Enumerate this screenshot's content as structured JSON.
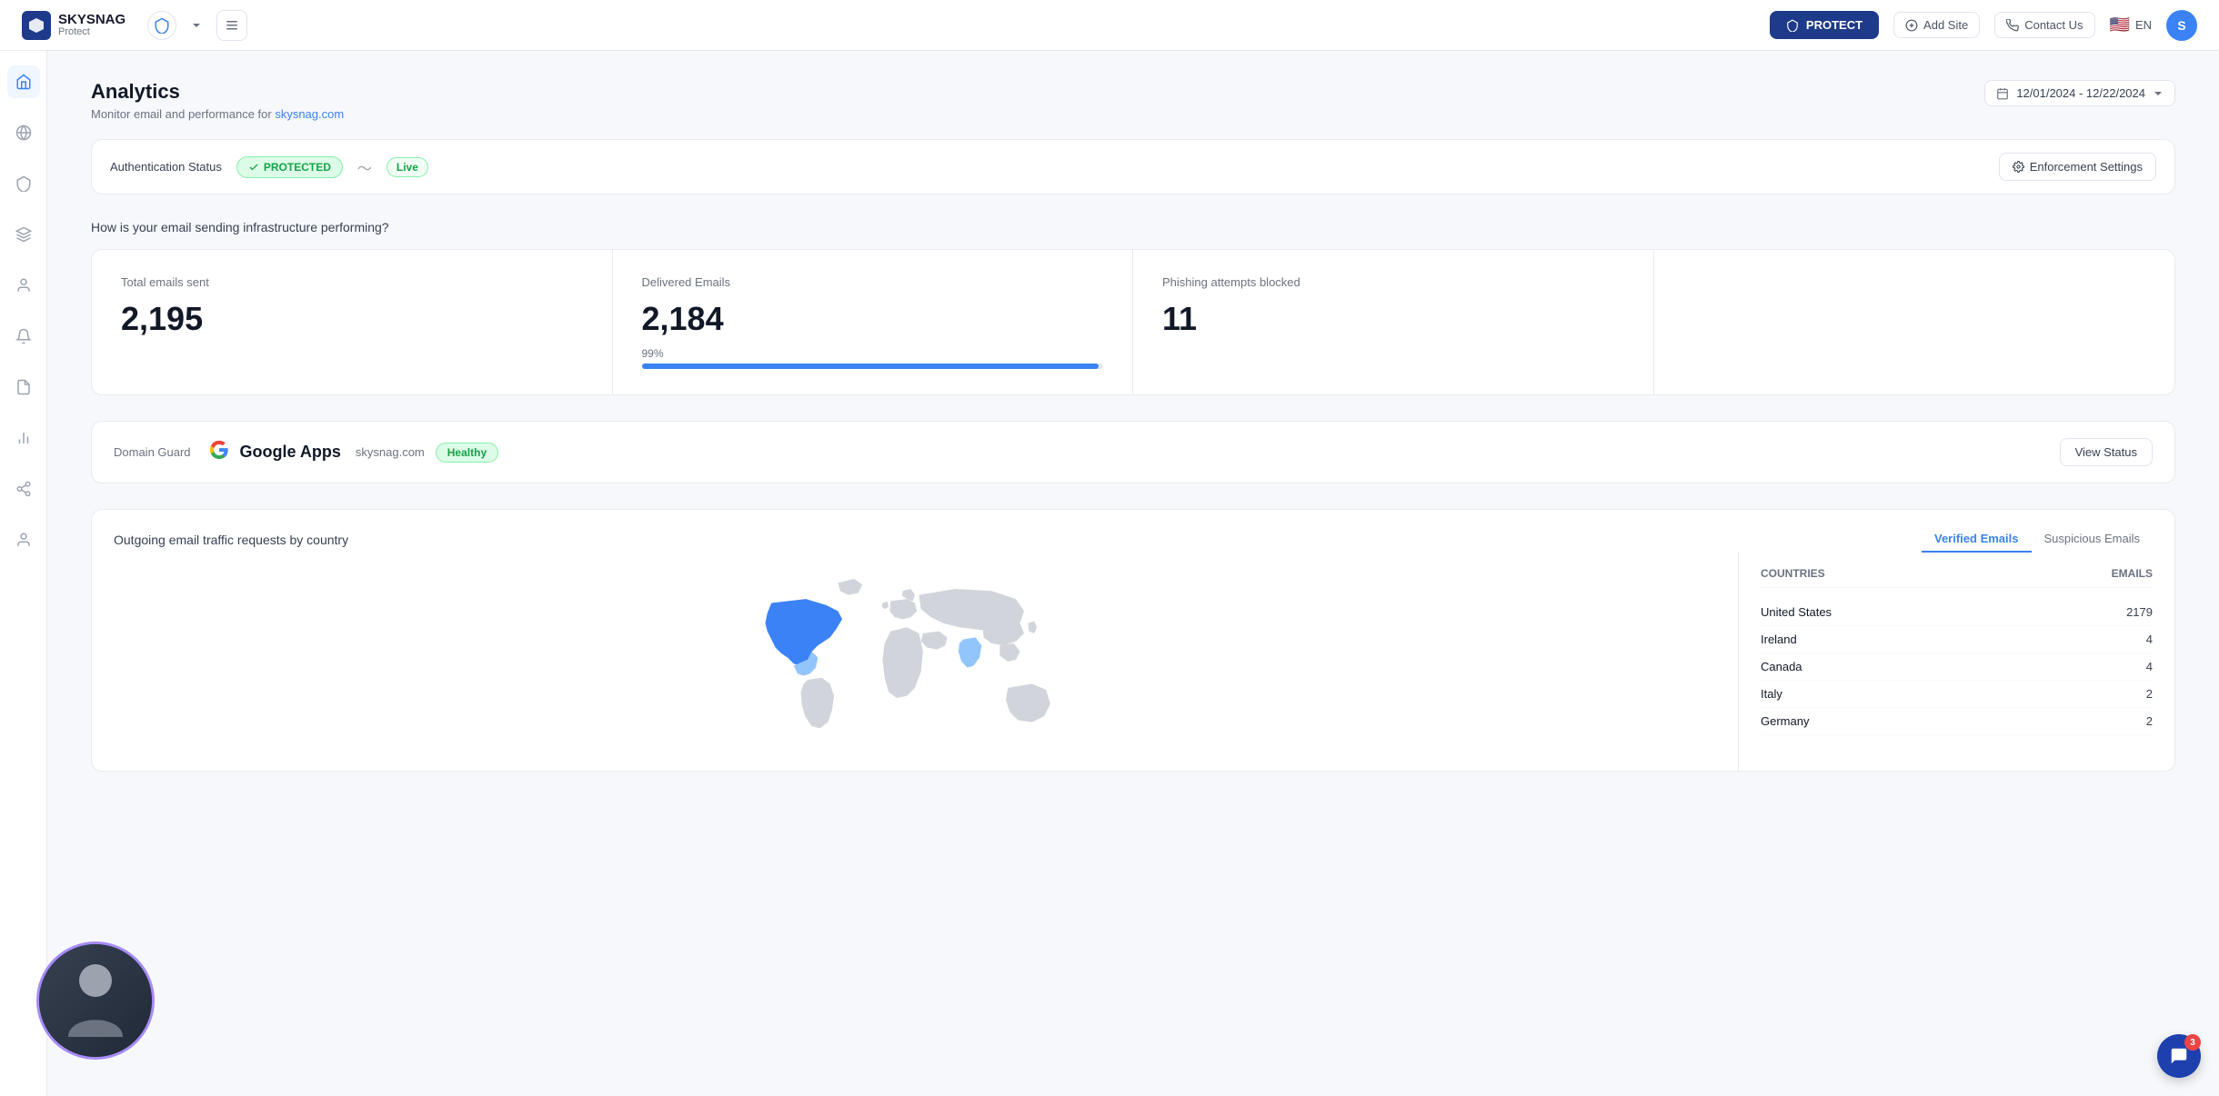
{
  "app": {
    "name": "SKYSNAG",
    "sub": "Protect"
  },
  "topbar": {
    "protect_label": "PROTECT",
    "add_site_label": "Add Site",
    "contact_us_label": "Contact Us",
    "lang": "EN",
    "avatar_initial": "S"
  },
  "sidebar": {
    "icons": [
      "home",
      "globe",
      "shield",
      "layers",
      "user",
      "bell",
      "report",
      "analytics",
      "settings",
      "user-circle"
    ]
  },
  "page": {
    "title": "Analytics",
    "subtitle": "Monitor email and performance for",
    "domain_link": "skysnag.com",
    "date_range": "12/01/2024 - 12/22/2024"
  },
  "auth_bar": {
    "label": "Authentication Status",
    "status": "PROTECTED",
    "live": "Live",
    "enforcement_btn": "Enforcement Settings"
  },
  "stats_section": {
    "question": "How is your email sending infrastructure performing?",
    "cards": [
      {
        "label": "Total emails sent",
        "value": "2,195"
      },
      {
        "label": "Delivered Emails",
        "value": "2,184",
        "pct": "99%",
        "bar_fill": 99
      },
      {
        "label": "Phishing attempts blocked",
        "value": "11"
      },
      {
        "label": "",
        "value": ""
      }
    ]
  },
  "domain_guard": {
    "label": "Domain Guard",
    "provider": "Google Apps",
    "domain": "skysnag.com",
    "status": "Healthy",
    "view_status_label": "View Status"
  },
  "map_section": {
    "label": "Outgoing email traffic requests by country",
    "tabs": [
      "Verified Emails",
      "Suspicious Emails"
    ],
    "active_tab": 0,
    "table_headers": [
      "Countries",
      "Emails"
    ],
    "rows": [
      {
        "country": "United States",
        "emails": "2179"
      },
      {
        "country": "Ireland",
        "emails": "4"
      },
      {
        "country": "Canada",
        "emails": "4"
      },
      {
        "country": "Italy",
        "emails": "2"
      },
      {
        "country": "Germany",
        "emails": "2"
      }
    ]
  },
  "chat": {
    "badge": "3"
  }
}
